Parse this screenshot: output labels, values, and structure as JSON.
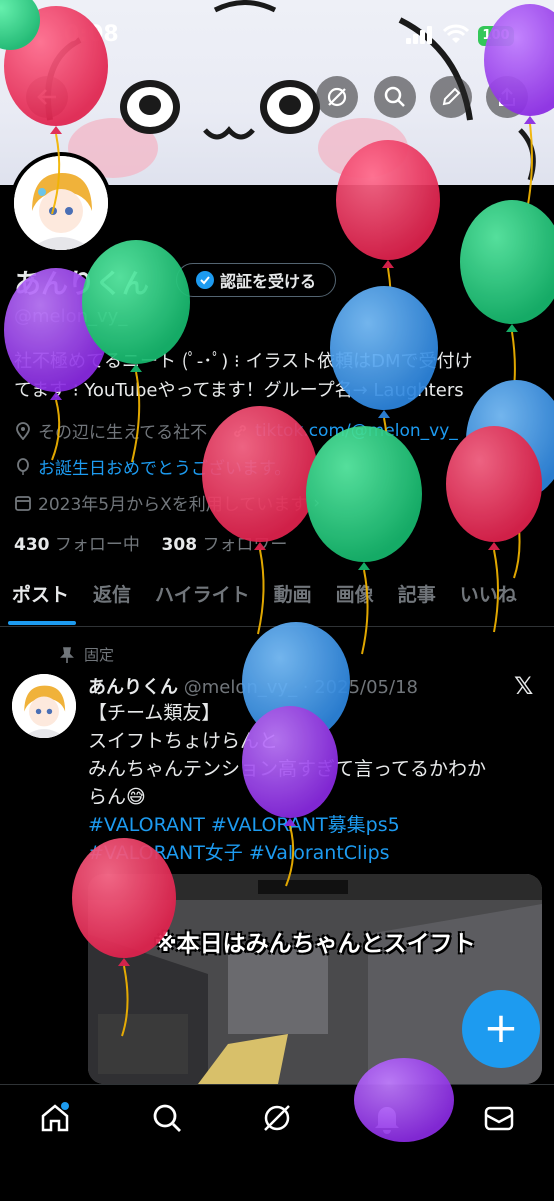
{
  "status": {
    "time": "0:08",
    "battery": "100"
  },
  "profile": {
    "name": "あんりくん",
    "verify_label": "認証を受ける",
    "handle": "@melon_vy_",
    "bio_line1": "社不極めてるニート (ﾟ-･ﾟ) ⁝ イラスト依頼はDMで受付け",
    "bio_line2": "てます ⁝ YouTubeやってます！グループ名→ Laughters",
    "location": "その辺に生えてる社不",
    "link": "tiktok.com/@melon_vy_",
    "birthday": "お誕生日おめでとうございます。",
    "joined": "2023年5月からXを利用しています",
    "following_count": "430",
    "following_label": "フォロー中",
    "followers_count": "308",
    "followers_label": "フォロワー"
  },
  "tabs": [
    "ポスト",
    "返信",
    "ハイライト",
    "動画",
    "画像",
    "記事",
    "いいね"
  ],
  "post": {
    "pinned_label": "固定",
    "name": "あんりくん",
    "handle_date": "@melon_vy_ · 2025/05/18",
    "line1": "【チーム類友】",
    "line2": "スイフトちょけらんと",
    "line3": "みんちゃんテンション高すぎて言ってるかわか",
    "line4": "らん😅",
    "tags1": "#VALORANT #VALORANT募集ps5",
    "tags2": "#VALORANT女子 #ValorantClips",
    "video_caption": "※本日はみんちゃんとスイフト"
  },
  "fab_label": "+",
  "colors": {
    "accent": "#1d9bf0",
    "background": "#000000",
    "muted": "#71767b"
  }
}
